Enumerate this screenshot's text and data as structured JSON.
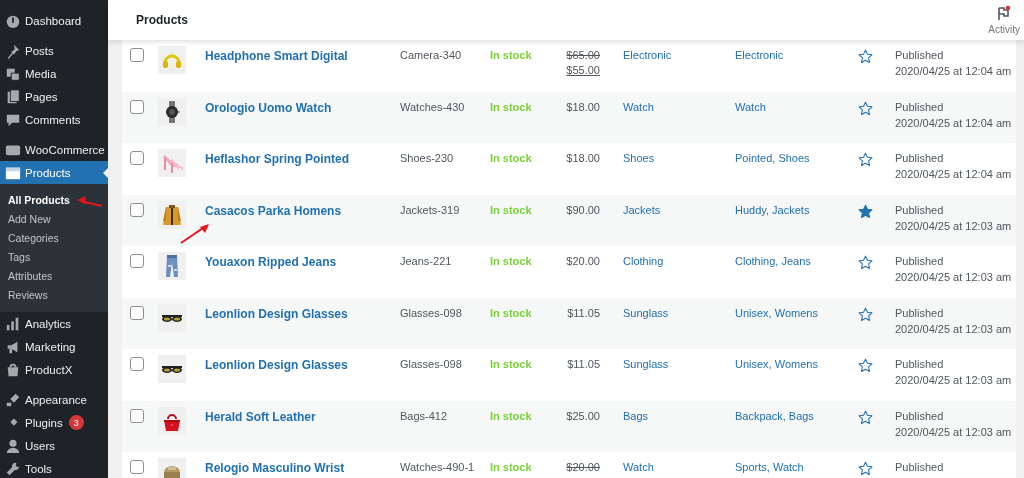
{
  "sidebar": {
    "groups": [
      [
        {
          "label": "Dashboard",
          "selected": false
        }
      ],
      [
        {
          "label": "Posts",
          "selected": false
        },
        {
          "label": "Media",
          "selected": false
        },
        {
          "label": "Pages",
          "selected": false
        },
        {
          "label": "Comments",
          "selected": false
        }
      ],
      [
        {
          "label": "WooCommerce",
          "selected": false
        },
        {
          "label": "Products",
          "selected": true,
          "children": [
            {
              "label": "All Products",
              "selected": true
            },
            {
              "label": "Add New",
              "selected": false
            },
            {
              "label": "Categories",
              "selected": false
            },
            {
              "label": "Tags",
              "selected": false
            },
            {
              "label": "Attributes",
              "selected": false
            },
            {
              "label": "Reviews",
              "selected": false
            }
          ]
        },
        {
          "label": "Analytics",
          "selected": false
        },
        {
          "label": "Marketing",
          "selected": false
        },
        {
          "label": "ProductX",
          "selected": false
        }
      ],
      [
        {
          "label": "Appearance",
          "selected": false
        },
        {
          "label": "Plugins",
          "selected": false,
          "badge": "3"
        },
        {
          "label": "Users",
          "selected": false
        },
        {
          "label": "Tools",
          "selected": false
        }
      ]
    ]
  },
  "header": {
    "title": "Products",
    "activity": {
      "label": "Activity",
      "unread": true
    }
  },
  "table": {
    "rows": [
      {
        "checked": false,
        "name": "Headphone Smart Digital",
        "sku": "Camera-340",
        "stock": "In stock",
        "price": {
          "regular": "$65.00",
          "sale": "$55.00",
          "on_sale": true
        },
        "categories": "Electronic",
        "tags": "Electronic",
        "featured": false,
        "status": "Published",
        "date": "2020/04/25 at 12:04 am"
      },
      {
        "checked": false,
        "name": "Orologio Uomo Watch",
        "sku": "Watches-430",
        "stock": "In stock",
        "price": {
          "regular": "$18.00",
          "on_sale": false
        },
        "categories": "Watch",
        "tags": "Watch",
        "featured": false,
        "status": "Published",
        "date": "2020/04/25 at 12:04 am"
      },
      {
        "checked": false,
        "name": "Heflashor Spring Pointed",
        "sku": "Shoes-230",
        "stock": "In stock",
        "price": {
          "regular": "$18.00",
          "on_sale": false
        },
        "categories": "Shoes",
        "tags": "Pointed, Shoes",
        "featured": false,
        "status": "Published",
        "date": "2020/04/25 at 12:04 am"
      },
      {
        "checked": false,
        "name": "Casacos Parka Homens",
        "sku": "Jackets-319",
        "stock": "In stock",
        "price": {
          "regular": "$90.00",
          "on_sale": false
        },
        "categories": "Jackets",
        "tags": "Huddy, Jackets",
        "featured": true,
        "status": "Published",
        "date": "2020/04/25 at 12:03 am"
      },
      {
        "checked": false,
        "name": "Youaxon Ripped Jeans",
        "sku": "Jeans-221",
        "stock": "In stock",
        "price": {
          "regular": "$20.00",
          "on_sale": false
        },
        "categories": "Clothing",
        "tags": "Clothing, Jeans",
        "featured": false,
        "status": "Published",
        "date": "2020/04/25 at 12:03 am"
      },
      {
        "checked": false,
        "name": "Leonlion Design Glasses",
        "sku": "Glasses-098",
        "stock": "In stock",
        "price": {
          "regular": "$11.05",
          "on_sale": false
        },
        "categories": "Sunglass",
        "tags": "Unisex, Womens",
        "featured": false,
        "status": "Published",
        "date": "2020/04/25 at 12:03 am"
      },
      {
        "checked": false,
        "name": "Leonlion Design Glasses",
        "sku": "Glasses-098",
        "stock": "In stock",
        "price": {
          "regular": "$11.05",
          "on_sale": false
        },
        "categories": "Sunglass",
        "tags": "Unisex, Womens",
        "featured": false,
        "status": "Published",
        "date": "2020/04/25 at 12:03 am"
      },
      {
        "checked": false,
        "name": "Herald Soft Leather",
        "sku": "Bags-412",
        "stock": "In stock",
        "price": {
          "regular": "$25.00",
          "on_sale": false
        },
        "categories": "Bags",
        "tags": "Backpack, Bags",
        "featured": false,
        "status": "Published",
        "date": "2020/04/25 at 12:03 am"
      },
      {
        "checked": false,
        "name": "Relogio Masculino Wrist",
        "sku": "Watches-490-1",
        "stock": "In stock",
        "price": {
          "regular": "$20.00",
          "on_sale": true
        },
        "categories": "Watch",
        "tags": "Sports, Watch",
        "featured": false,
        "status": "Published"
      }
    ]
  }
}
